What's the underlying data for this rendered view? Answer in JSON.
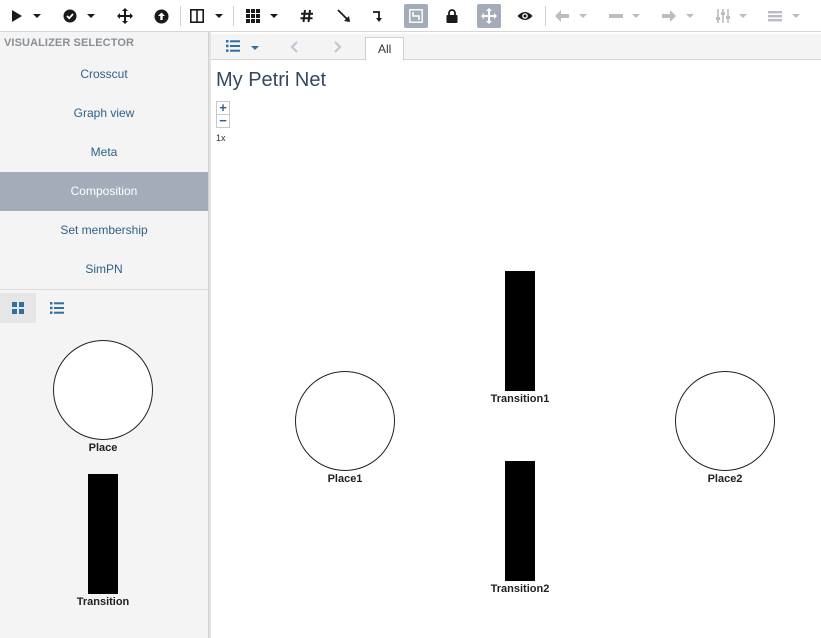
{
  "toolbar": {
    "icons": [
      "play-icon",
      "check-circle-icon",
      "move-arrows-icon",
      "upload-icon",
      "columns-icon",
      "grid-icon",
      "hash-icon",
      "arrow-diagonal-icon",
      "connector-icon",
      "layout-icon",
      "lock-icon",
      "pan-icon",
      "eye-icon",
      "arrow-left-icon",
      "minus-icon",
      "arrow-right-icon",
      "sliders-icon",
      "menu-lines-icon"
    ]
  },
  "left_panel": {
    "title": "VISUALIZER SELECTOR",
    "items": [
      {
        "label": "Crosscut"
      },
      {
        "label": "Graph view"
      },
      {
        "label": "Meta"
      },
      {
        "label": "Composition",
        "active": true
      },
      {
        "label": "Set membership"
      },
      {
        "label": "SimPN"
      }
    ],
    "palette": {
      "place_label": "Place",
      "transition_label": "Transition"
    }
  },
  "main": {
    "tab_label": "All",
    "title": "My Petri Net",
    "zoom_in": "+",
    "zoom_out": "−",
    "zoom_level": "1x",
    "nodes": {
      "place1": "Place1",
      "place2": "Place2",
      "transition1": "Transition1",
      "transition2": "Transition2"
    }
  },
  "colors": {
    "accent": "#a3acb8",
    "link": "#2f5f8a",
    "panel_bg": "#f4f4f4"
  }
}
